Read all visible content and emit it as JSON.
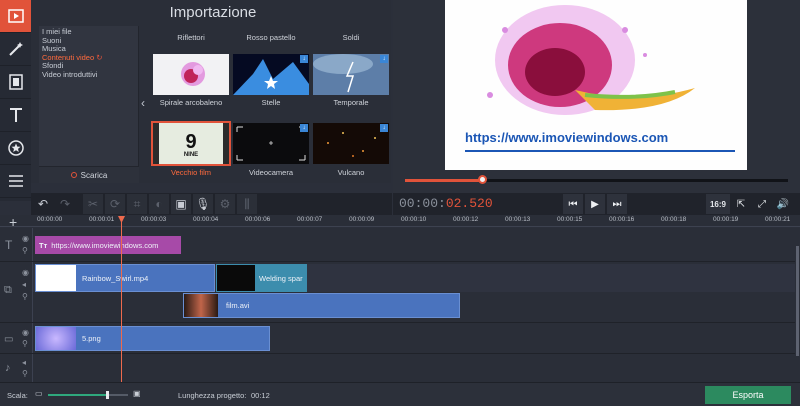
{
  "import": {
    "title": "Importazione",
    "categories": [
      "I miei file",
      "Suoni",
      "Musica",
      "Contenuti video",
      "Sfondi",
      "Video introduttivi"
    ],
    "selected_category": "Contenuti video",
    "download_label": "Scarica",
    "row0_labels": [
      "Riflettori",
      "Rosso pastello",
      "Soldi"
    ],
    "tiles": [
      {
        "label": "Spirale arcobaleno",
        "icon": "none"
      },
      {
        "label": "Stelle",
        "icon": "download-icon"
      },
      {
        "label": "Temporale",
        "icon": "download-icon"
      },
      {
        "label": "Vecchio film",
        "icon": "none",
        "selected": true,
        "thumb_text": "NINE"
      },
      {
        "label": "Videocamera",
        "icon": "download-icon"
      },
      {
        "label": "Vulcano",
        "icon": "download-icon"
      }
    ]
  },
  "preview": {
    "overlay_text": "https://www.imoviewindows.com",
    "progress": 0.2
  },
  "playback": {
    "time_prefix": "00:00:",
    "time_value": "02.520",
    "aspect": "16:9"
  },
  "ruler": {
    "ticks": [
      "00:00:00",
      "00:00:01",
      "00:00:03",
      "00:00:04",
      "00:00:06",
      "00:00:07",
      "00:00:09",
      "00:00:10",
      "00:00:12",
      "00:00:13",
      "00:00:15",
      "00:00:16",
      "00:00:18",
      "00:00:19",
      "00:00:21"
    ]
  },
  "timeline": {
    "title_clip": "https://www.imoviewindows.com",
    "video_clip_1": "Rainbow_Swirl.mp4",
    "video_clip_2": "Welding spar",
    "video_clip_3": "film.avi",
    "image_clip": "5.png"
  },
  "bottom": {
    "scale_label": "Scala:",
    "project_length_label": "Lunghezza progetto:",
    "project_length_value": "00:12",
    "export_label": "Esporta"
  },
  "colors": {
    "accent": "#e1533a",
    "clip_blue": "#4a73be",
    "export_green": "#2c8a5f",
    "title_clip": "#a74aa8"
  }
}
